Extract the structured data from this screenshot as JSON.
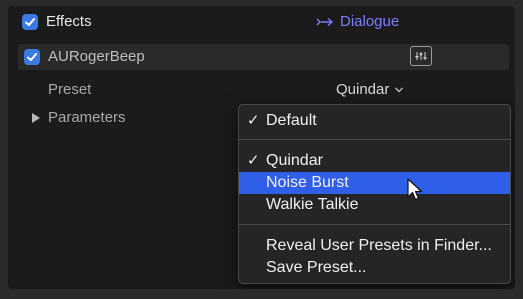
{
  "header": {
    "effects_label": "Effects",
    "dialogue_label": "Dialogue",
    "dialogue_arrow": "→"
  },
  "plugin": {
    "name": "AURogerBeep"
  },
  "preset_row": {
    "label": "Preset",
    "value": "Quindar",
    "chevron": "⌄"
  },
  "params_row": {
    "label": "Parameters"
  },
  "menu": {
    "check_glyph": "✓",
    "items": [
      {
        "label": "Default",
        "checked": true
      },
      {
        "label": "Quindar",
        "checked": true
      },
      {
        "label": "Noise Burst",
        "checked": false,
        "highlighted": true
      },
      {
        "label": "Walkie Talkie",
        "checked": false
      },
      {
        "label": "Reveal User Presets in Finder...",
        "checked": false
      },
      {
        "label": "Save Preset...",
        "checked": false
      }
    ]
  },
  "colors": {
    "accent": "#3b7ae0",
    "highlight": "#2f5fe6",
    "dialogue": "#7b7cff"
  }
}
